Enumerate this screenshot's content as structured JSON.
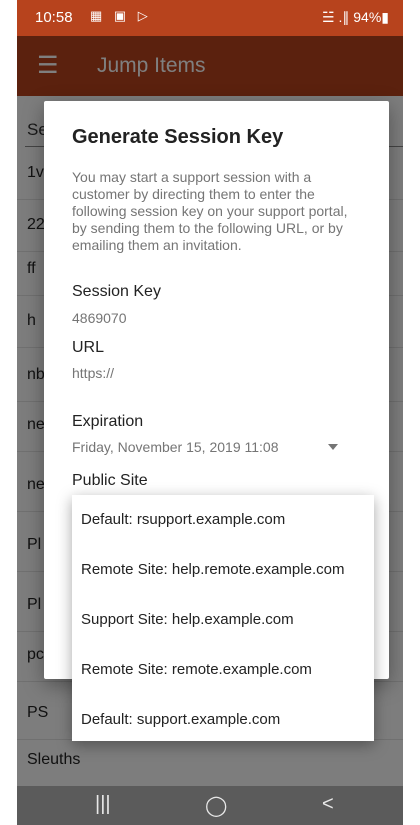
{
  "status_bar": {
    "time": "10:58",
    "icons": "▦ ▣ ▷",
    "signal": "☱ .∥",
    "battery": "94%▮"
  },
  "app_bar": {
    "title": "Jump Items"
  },
  "list": {
    "search_hint": "Se",
    "items": [
      "1v",
      "22",
      "ff",
      "h",
      "nb",
      "ne",
      "ne",
      "Pl",
      "Pl",
      "pc",
      "PS",
      "Sleuths"
    ]
  },
  "dialog": {
    "title": "Generate Session Key",
    "description": "You may start a support session with a customer by directing them to enter the following session key on your support portal, by sending them to the following URL, or by emailing them an invitation.",
    "session_key_label": "Session Key",
    "session_key_value": "4869070",
    "url_label": "URL",
    "url_value": "https://",
    "expiration_label": "Expiration",
    "expiration_value": "Friday, November 15, 2019 11:08",
    "public_site_label": "Public Site"
  },
  "dropdown": {
    "options": [
      "Default: rsupport.example.com",
      "Remote Site: help.remote.example.com",
      "Support Site: help.example.com",
      "Remote Site: remote.example.com",
      "Default: support.example.com"
    ]
  },
  "nav_bar": {
    "recents": "|||",
    "home": "◯",
    "back": "<"
  }
}
